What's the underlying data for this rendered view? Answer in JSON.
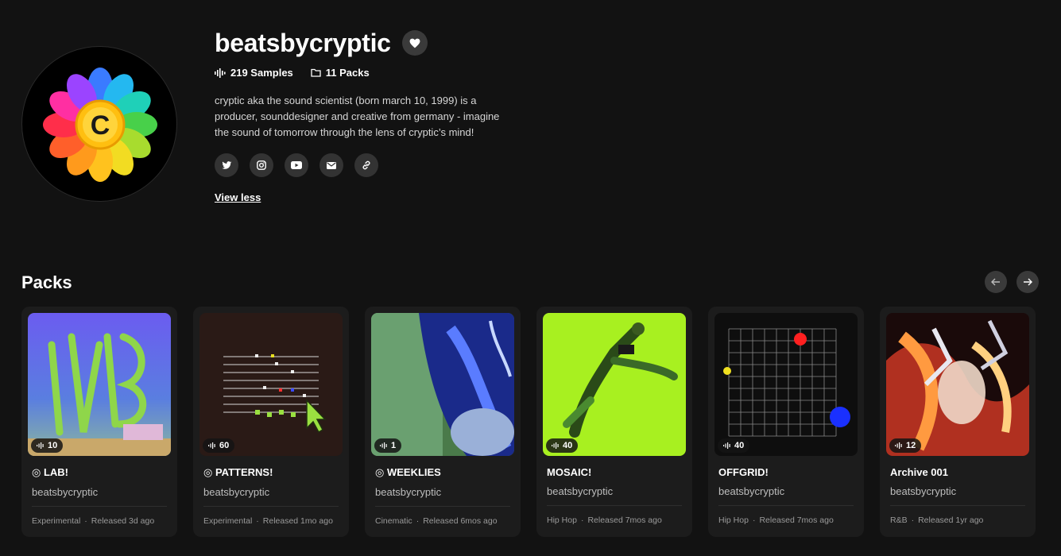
{
  "profile": {
    "name": "beatsbycryptic",
    "samples": "219 Samples",
    "packs": "11 Packs",
    "bio": "cryptic aka the sound scientist (born march 10, 1999) is a producer, sounddesigner and creative from germany - imagine the sound of tomorrow through the lens of cryptic’s mind!",
    "view_less": "View less",
    "avatar_letter": "C",
    "socials": [
      "twitter-icon",
      "instagram-icon",
      "youtube-icon",
      "mail-icon",
      "link-icon"
    ]
  },
  "packs_section": {
    "title": "Packs"
  },
  "packs": [
    {
      "title": "◎ LAB!",
      "artist": "beatsbycryptic",
      "count": "10",
      "genre": "Experimental",
      "released": "Released 3d ago"
    },
    {
      "title": "◎ PATTERNS!",
      "artist": "beatsbycryptic",
      "count": "60",
      "genre": "Experimental",
      "released": "Released 1mo ago"
    },
    {
      "title": "◎ WEEKLIES",
      "artist": "beatsbycryptic",
      "count": "1",
      "genre": "Cinematic",
      "released": "Released 6mos ago"
    },
    {
      "title": "MOSAIC!",
      "artist": "beatsbycryptic",
      "count": "40",
      "genre": "Hip Hop",
      "released": "Released 7mos ago"
    },
    {
      "title": "OFFGRID!",
      "artist": "beatsbycryptic",
      "count": "40",
      "genre": "Hip Hop",
      "released": "Released 7mos ago"
    },
    {
      "title": "Archive 001",
      "artist": "beatsbycryptic",
      "count": "12",
      "genre": "R&B",
      "released": "Released 1yr ago"
    }
  ],
  "colors": {
    "background": "#121212",
    "card": "#1c1c1c",
    "button": "#3a3a3a"
  }
}
